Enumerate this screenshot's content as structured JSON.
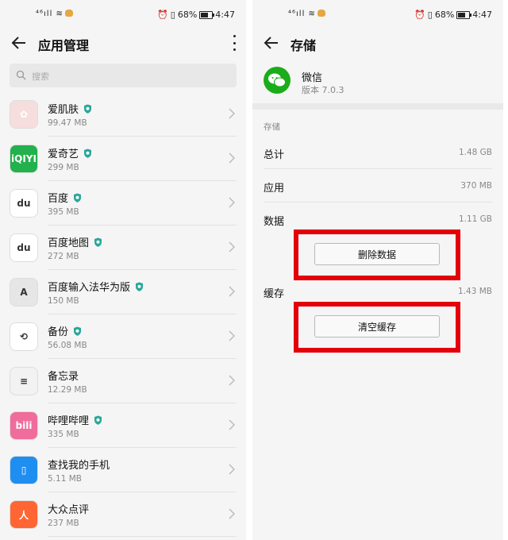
{
  "status_bar": {
    "signal_text": "⁴⁶ıll",
    "battery_text": "68%",
    "time": "4:47"
  },
  "left": {
    "title": "应用管理",
    "search_placeholder": "搜索",
    "apps": [
      {
        "name": "爱肌肤",
        "size": "99.47 MB",
        "icon": "aijifu-icon",
        "icon_color": "#f7dede",
        "glyph": "✿",
        "verified": true
      },
      {
        "name": "爱奇艺",
        "size": "299 MB",
        "icon": "iqiyi-icon",
        "icon_color": "#22b14c",
        "glyph": "iQIYI",
        "verified": true
      },
      {
        "name": "百度",
        "size": "395 MB",
        "icon": "baidu-icon",
        "icon_color": "#ffffff",
        "glyph": "du",
        "verified": true
      },
      {
        "name": "百度地图",
        "size": "272 MB",
        "icon": "baidu-map-icon",
        "icon_color": "#ffffff",
        "glyph": "du",
        "verified": true
      },
      {
        "name": "百度输入法华为版",
        "size": "150 MB",
        "icon": "baidu-input-icon",
        "icon_color": "#e6e6e6",
        "glyph": "A",
        "verified": true
      },
      {
        "name": "备份",
        "size": "56.08 MB",
        "icon": "backup-icon",
        "icon_color": "#ffffff",
        "glyph": "⟲",
        "verified": true
      },
      {
        "name": "备忘录",
        "size": "12.29 MB",
        "icon": "notepad-icon",
        "icon_color": "#f2f2f2",
        "glyph": "≡",
        "verified": false
      },
      {
        "name": "哔哩哔哩",
        "size": "335 MB",
        "icon": "bilibili-icon",
        "icon_color": "#f06d9b",
        "glyph": "bili",
        "verified": true
      },
      {
        "name": "查找我的手机",
        "size": "5.11 MB",
        "icon": "find-phone-icon",
        "icon_color": "#1f8ef1",
        "glyph": "▯",
        "verified": false
      },
      {
        "name": "大众点评",
        "size": "237 MB",
        "icon": "dianping-icon",
        "icon_color": "#ff6633",
        "glyph": "人",
        "verified": false
      }
    ]
  },
  "right": {
    "title": "存储",
    "app_name": "微信",
    "app_version": "版本 7.0.3",
    "section_label": "存储",
    "rows": [
      {
        "label": "总计",
        "value": "1.48 GB"
      },
      {
        "label": "应用",
        "value": "370 MB"
      },
      {
        "label": "数据",
        "value": "1.11 GB"
      }
    ],
    "delete_data_button": "删除数据",
    "cache_label": "缓存",
    "cache_value": "1.43 MB",
    "clear_cache_button": "清空缓存",
    "highlight_color": "#e3000b"
  }
}
